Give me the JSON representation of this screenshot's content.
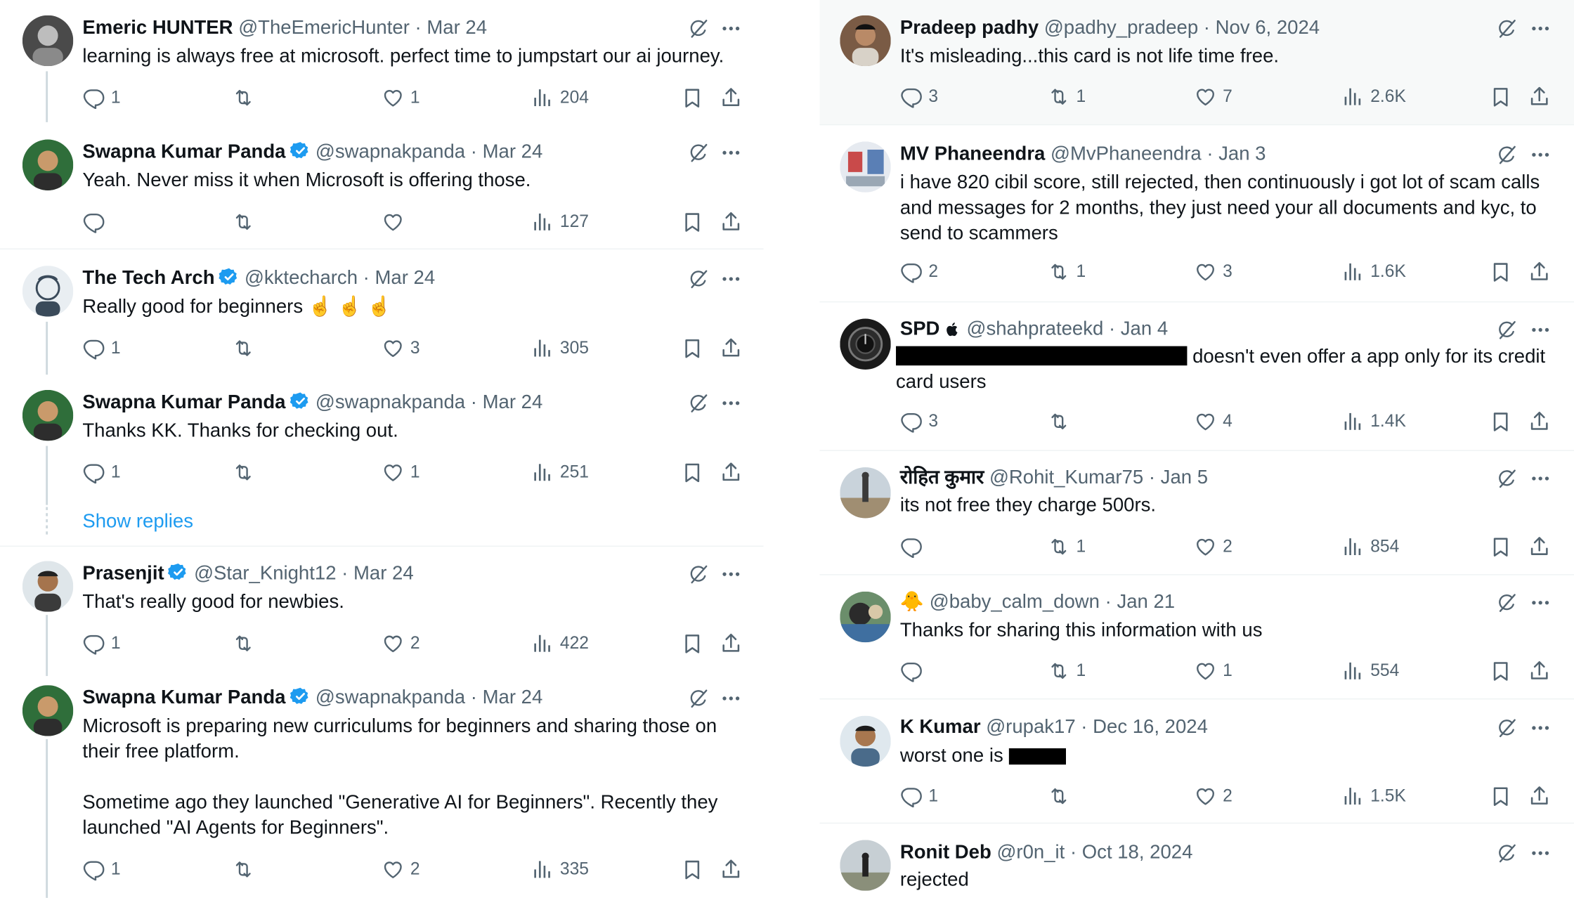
{
  "left": {
    "tweets": [
      {
        "name": "Emeric HUNTER",
        "verified": false,
        "handle": "@TheEmericHunter",
        "date": "Mar 24",
        "text": "learning is always free at microsoft. perfect time to jumpstart our ai journey.",
        "replies": "1",
        "reposts": "",
        "likes": "1",
        "views": "204"
      },
      {
        "name": "Swapna Kumar Panda",
        "verified": true,
        "handle": "@swapnakpanda",
        "date": "Mar 24",
        "text": "Yeah. Never miss it when Microsoft is offering those.",
        "replies": "",
        "reposts": "",
        "likes": "",
        "views": "127"
      },
      {
        "name": "The Tech Arch",
        "verified": true,
        "handle": "@kktecharch",
        "date": "Mar 24",
        "text": "Really good for beginners ☝️ ☝️ ☝️",
        "replies": "1",
        "reposts": "",
        "likes": "3",
        "views": "305"
      },
      {
        "name": "Swapna Kumar Panda",
        "verified": true,
        "handle": "@swapnakpanda",
        "date": "Mar 24",
        "text": "Thanks KK. Thanks for checking out.",
        "replies": "1",
        "reposts": "",
        "likes": "1",
        "views": "251"
      },
      {
        "name": "Prasenjit",
        "verified": true,
        "handle": "@Star_Knight12",
        "date": "Mar 24",
        "text": "That's really good for newbies.",
        "replies": "1",
        "reposts": "",
        "likes": "2",
        "views": "422"
      },
      {
        "name": "Swapna Kumar Panda",
        "verified": true,
        "handle": "@swapnakpanda",
        "date": "Mar 24",
        "text": "Microsoft is preparing new curriculums for beginners and sharing those on their free platform.\n\nSometime ago they launched \"Generative AI for Beginners\". Recently they launched \"AI Agents for Beginners\".",
        "replies": "1",
        "reposts": "",
        "likes": "2",
        "views": "335"
      }
    ],
    "show_replies": "Show replies"
  },
  "right": {
    "tweets": [
      {
        "name": "Pradeep padhy",
        "handle": "@padhy_pradeep",
        "date": "Nov 6, 2024",
        "text": "It's misleading...this card is not life time free.",
        "replies": "3",
        "reposts": "1",
        "likes": "7",
        "views": "2.6K"
      },
      {
        "name": "MV Phaneendra",
        "handle": "@MvPhaneendra",
        "date": "Jan 3",
        "text": "i have 820 cibil score, still rejected, then continuously i got lot of scam calls and messages for 2 months, they just need your all documents and kyc, to send to scammers",
        "replies": "2",
        "reposts": "1",
        "likes": "3",
        "views": "1.6K"
      },
      {
        "name": "SPD",
        "name_suffix": "",
        "handle": "@shahprateekd",
        "date": "Jan 4",
        "text_after_redaction": " doesn't even offer a app only for its credit card users",
        "replies": "3",
        "reposts": "",
        "likes": "4",
        "views": "1.4K"
      },
      {
        "name": "रोहित कुमार",
        "handle": "@Rohit_Kumar75",
        "date": "Jan 5",
        "text": "its not free they charge 500rs.",
        "replies": "",
        "reposts": "1",
        "likes": "2",
        "views": "854"
      },
      {
        "name": "🐥",
        "handle": "@baby_calm_down",
        "date": "Jan 21",
        "text": "Thanks for sharing this information with us",
        "replies": "",
        "reposts": "1",
        "likes": "1",
        "views": "554"
      },
      {
        "name": "K Kumar",
        "handle": "@rupak17",
        "date": "Dec 16, 2024",
        "text": "worst one is ",
        "replies": "1",
        "reposts": "",
        "likes": "2",
        "views": "1.5K"
      },
      {
        "name": "Ronit Deb",
        "handle": "@r0n_it",
        "date": "Oct 18, 2024",
        "text": "rejected"
      }
    ]
  },
  "separator": "·",
  "icons": {
    "reply": "reply-icon",
    "repost": "repost-icon",
    "like": "like-icon",
    "views": "views-icon",
    "bookmark": "bookmark-icon",
    "share": "share-icon",
    "grok": "grok-icon",
    "more": "more-icon",
    "verified": "verified-badge-icon"
  },
  "colors": {
    "text": "#0f1419",
    "muted": "#536471",
    "link": "#1d9bf0",
    "verified": "#1d9bf0",
    "divider": "#eff3f4",
    "shaded_bg": "#f7f9f9"
  }
}
